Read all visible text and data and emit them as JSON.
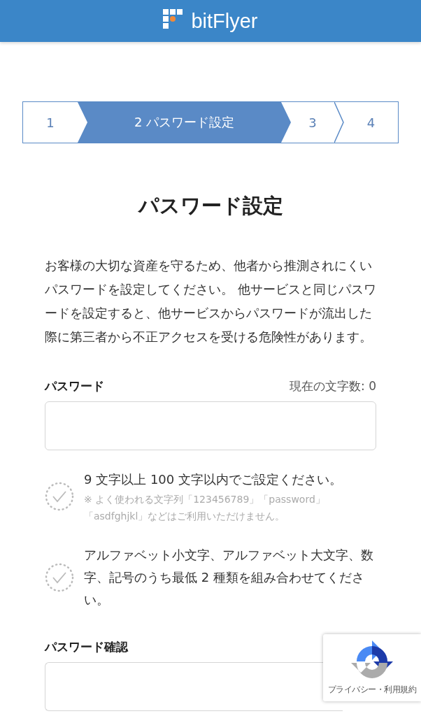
{
  "header": {
    "logo_text": "bitFlyer"
  },
  "steps": [
    {
      "number": "1",
      "selected": false
    },
    {
      "number": "2",
      "label": "パスワード設定",
      "selected": true
    },
    {
      "number": "3",
      "selected": false
    },
    {
      "number": "4",
      "selected": false
    }
  ],
  "title": "パスワード設定",
  "description": "お客様の大切な資産を守るため、他者から推測されにくいパスワードを設定してください。 他サービスと同じパスワードを設定すると、他サービスからパスワードが流出した際に第三者から不正アクセスを受ける危険性があります。",
  "password": {
    "label": "パスワード",
    "counter": "現在の文字数: 0"
  },
  "requirements": [
    {
      "text": "9 文字以上 100 文字以内でご設定ください。",
      "note": "※ よく使われる文字列「123456789」「password」「asdfghjkl」などはご利用いただけません。",
      "met": false
    },
    {
      "text": "アルファベット小文字、アルファベット大文字、数字、記号のうち最低 2 種類を組み合わせてください。",
      "met": false
    }
  ],
  "confirm": {
    "label": "パスワード確認"
  },
  "recaptcha": {
    "links": "プライバシー・利用規約"
  }
}
